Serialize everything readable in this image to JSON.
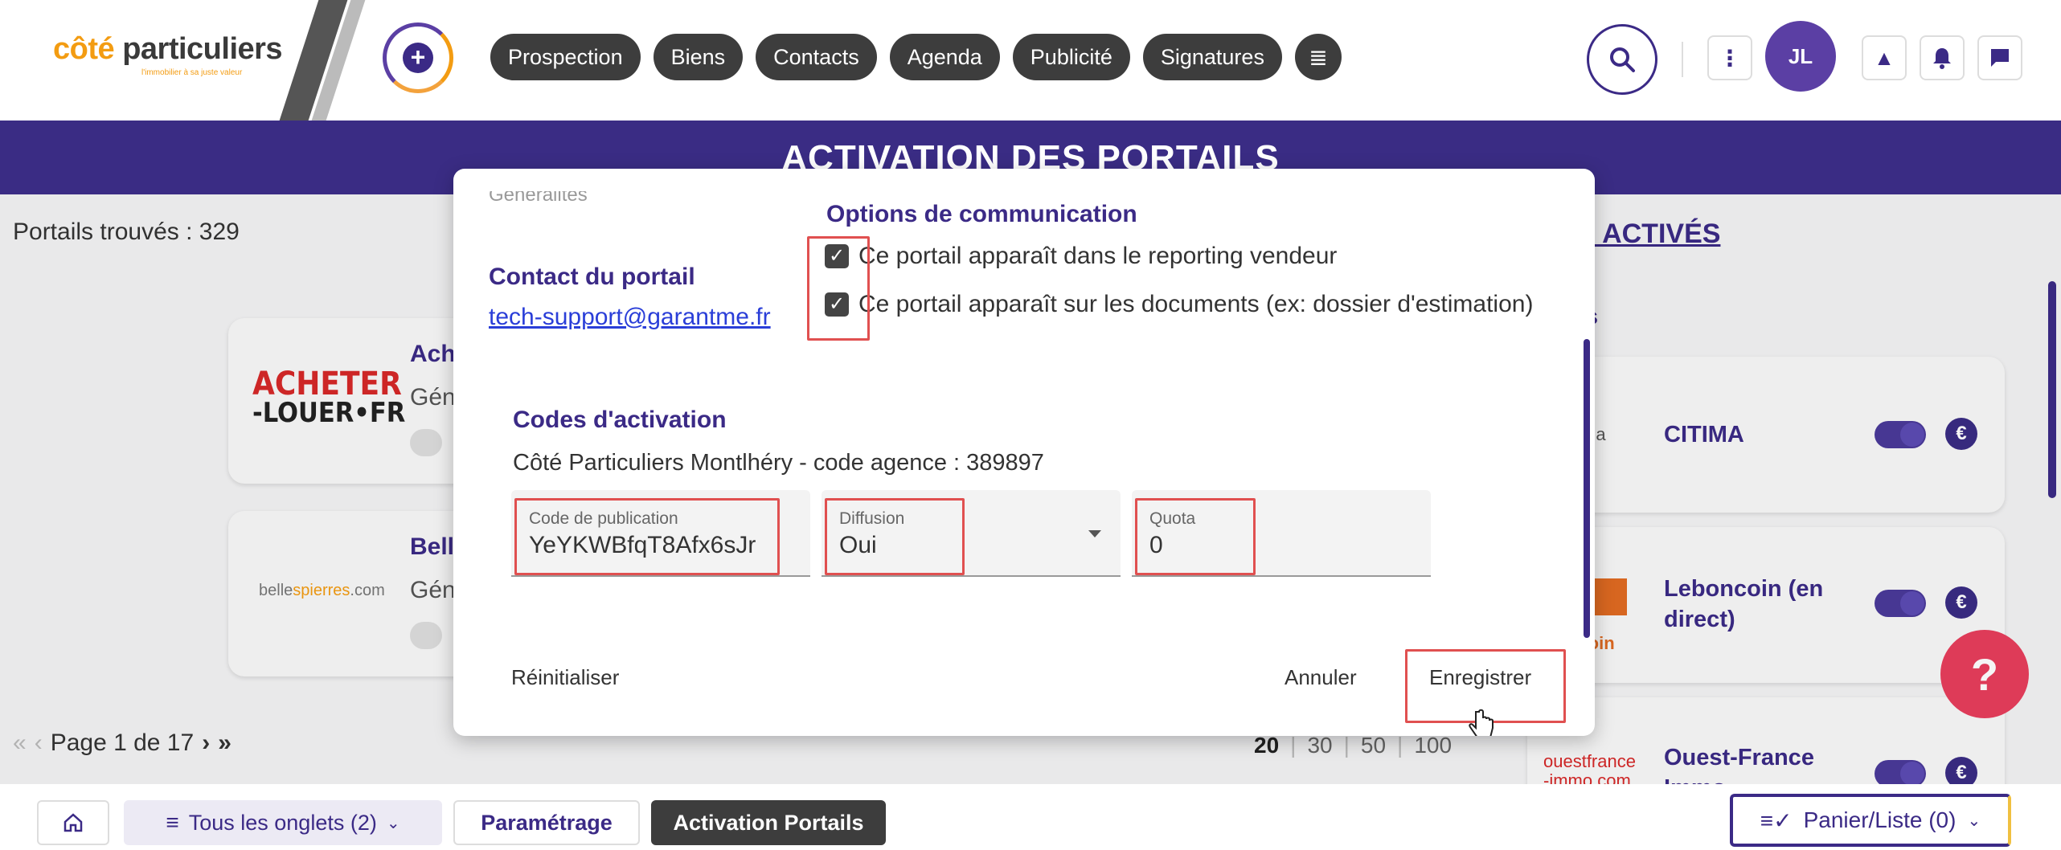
{
  "header": {
    "logo": {
      "main_a": "côté",
      "main_b": " particuliers",
      "tagline": "l'immobilier à sa juste valeur"
    },
    "nav": [
      "Prospection",
      "Biens",
      "Contacts",
      "Agenda",
      "Publicité",
      "Signatures"
    ],
    "avatar_initials": "JL",
    "icons": [
      "add-icon",
      "menu-icon",
      "search-icon",
      "more-vertical-icon",
      "alert-icon",
      "bell-icon",
      "chat-icon"
    ]
  },
  "banner": {
    "title": "ACTIVATION DES PORTAILS"
  },
  "list": {
    "count_label": "Portails trouvés : 329",
    "cards": [
      {
        "logo_line1": "ACHETER",
        "logo_line2": "-LOUER•FR",
        "name": "Ach",
        "sub": "Gén"
      },
      {
        "logo_a": "belle",
        "logo_b": "spierres",
        "logo_c": ".com",
        "name": "Bell",
        "sub": "Gén"
      }
    ],
    "pager": {
      "first": "«",
      "prev": "‹",
      "label": "Page 1 de 17",
      "next": "›",
      "last": "»"
    },
    "page_sizes": [
      "20",
      "30",
      "50",
      "100"
    ]
  },
  "right_panel": {
    "heading": "ILS ACTIVÉS",
    "subheading": "stes",
    "items": [
      {
        "logo": "tima",
        "name": "CITIMA"
      },
      {
        "logo": "ncoin",
        "name": "Leboncoin (en direct)"
      },
      {
        "logo_line1": "ouestfrance",
        "logo_line2": "-immo.com",
        "name": "Ouest-France",
        "name_cut": "Immo"
      }
    ]
  },
  "help_label": "?",
  "modal": {
    "cut_section_label": "Généralités",
    "contact_title": "Contact du portail",
    "contact_email": "tech-support@garantme.fr",
    "options_title": "Options de communication",
    "options": [
      {
        "label": "Ce portail apparaît dans le reporting vendeur",
        "checked": true
      },
      {
        "label": "Ce portail apparaît sur les documents (ex: dossier d'estimation)",
        "checked": true
      }
    ],
    "codes_title": "Codes d'activation",
    "agency_line": "Côté Particuliers Montlhéry - code agence : 389897",
    "fields": {
      "code_label": "Code de publication",
      "code_value": "YeYKWBfqT8Afx6sJr",
      "diffusion_label": "Diffusion",
      "diffusion_value": "Oui",
      "quota_label": "Quota",
      "quota_value": "0"
    },
    "buttons": {
      "reset": "Réinitialiser",
      "cancel": "Annuler",
      "save": "Enregistrer"
    }
  },
  "bottom_bar": {
    "tabs_label": "Tous les onglets (2)",
    "tab_param": "Paramétrage",
    "tab_active": "Activation Portails",
    "panier": "Panier/Liste (0)"
  },
  "colors": {
    "primary": "#3a2c84",
    "accent": "#f39c12",
    "highlight": "#e05050",
    "help": "#e83e5c"
  }
}
